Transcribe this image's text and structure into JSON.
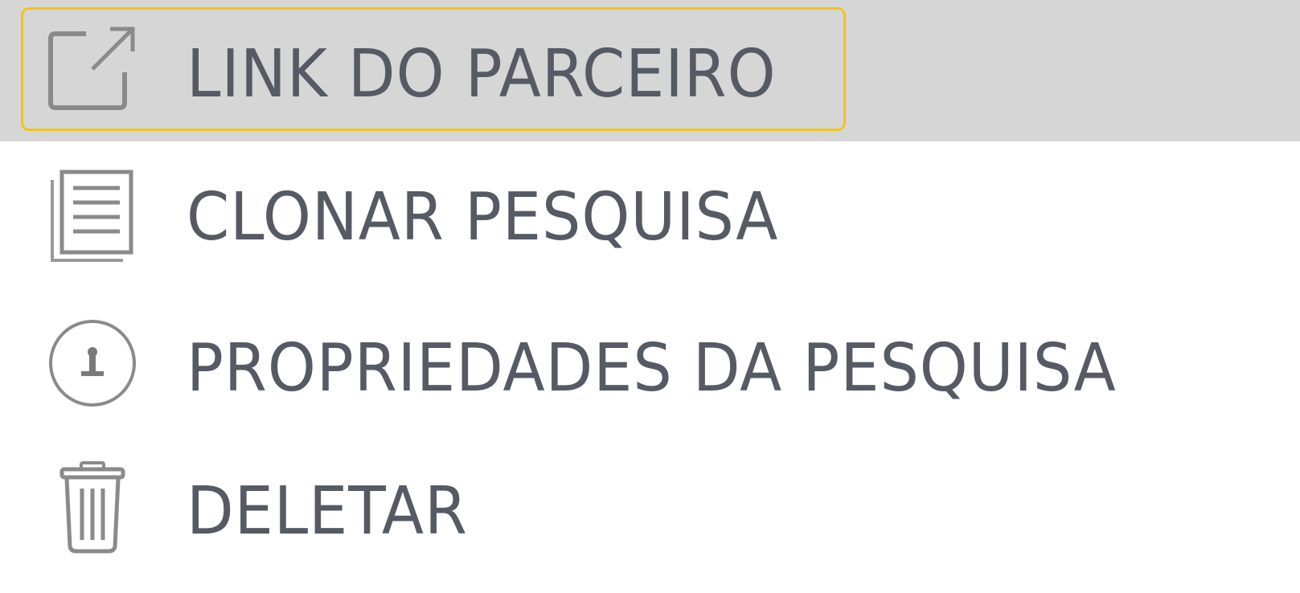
{
  "menu": {
    "items": [
      {
        "label": "LINK DO PARCEIRO",
        "icon": "external-link-icon"
      },
      {
        "label": "CLONAR PESQUISA",
        "icon": "copy-document-icon"
      },
      {
        "label": "PROPRIEDADES DA PESQUISA",
        "icon": "properties-icon"
      },
      {
        "label": "DELETAR",
        "icon": "trash-icon"
      }
    ],
    "active_index": 0
  },
  "colors": {
    "active_background": "#d6d6d6",
    "focus_ring": "#f2c418",
    "text": "#555a64",
    "icon": "#8a8a8a"
  }
}
